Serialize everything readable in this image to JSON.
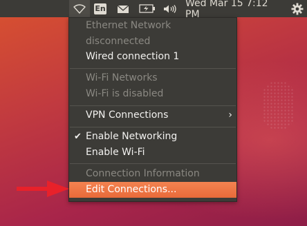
{
  "panel": {
    "keyboard_layout": "En",
    "clock": "Wed Mar 15  7:12 PM",
    "icons": [
      "network-wireless-icon",
      "keyboard-layout-icon",
      "mail-icon",
      "battery-icon",
      "volume-icon",
      "gear-icon"
    ]
  },
  "menu": {
    "ethernet_header": "Ethernet Network",
    "ethernet_status": "disconnected",
    "wired_connection": "Wired connection 1",
    "wifi_header": "Wi-Fi Networks",
    "wifi_status": "Wi-Fi is disabled",
    "vpn": "VPN Connections",
    "enable_networking": "Enable Networking",
    "enable_networking_checked": true,
    "enable_wifi": "Enable Wi-Fi",
    "connection_info": "Connection Information",
    "edit_connections": "Edit Connections..."
  },
  "colors": {
    "panel_bg": "#3c3b37",
    "highlight": "#f07746",
    "arrow": "#e8212a"
  }
}
